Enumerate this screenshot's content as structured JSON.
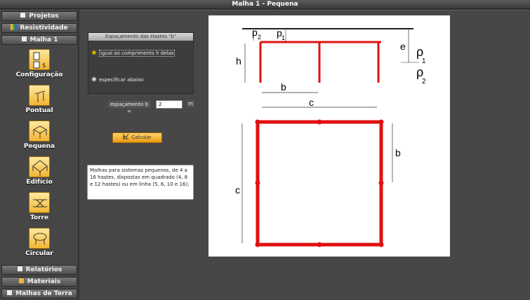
{
  "window": {
    "title": "Malha 1 - Pequena"
  },
  "sidebar": {
    "top_buttons": [
      {
        "label": "Projetos",
        "icon": "document-icon"
      },
      {
        "label": "Resistividade",
        "icon": "chart-icon"
      },
      {
        "label": "Malha 1",
        "icon": "document-icon"
      }
    ],
    "tools": [
      {
        "label": "Configuração",
        "icon": "configuration-icon"
      },
      {
        "label": "Pontual",
        "icon": "single-rod-icon"
      },
      {
        "label": "Pequena",
        "icon": "small-grid-icon"
      },
      {
        "label": "Edifício",
        "icon": "building-icon"
      },
      {
        "label": "Torre",
        "icon": "tower-icon"
      },
      {
        "label": "Circular",
        "icon": "circular-icon"
      }
    ],
    "bottom_buttons": [
      {
        "label": "Relatórios",
        "icon": "document-icon"
      },
      {
        "label": "Materiais",
        "icon": "materials-icon"
      },
      {
        "label": "Malhas de Terra",
        "icon": "grounding-icon"
      }
    ]
  },
  "spacing_panel": {
    "header": "Espaçamento das Hastes \"b\"",
    "option_equal": "igual ao comprimento h delas",
    "option_specify": "especificar abaixo",
    "selected": "option_equal"
  },
  "spacing_field": {
    "label": "espaçamento b =",
    "value": "2",
    "unit": "m"
  },
  "calc_button": {
    "label": "Calcular",
    "icon": "calculator-icon"
  },
  "description": "Malhas para sistemas pequenos, de 4 a 16 hastes, dispostas em quadrado (4, 8 e 12 hastes) ou em linha (5, 6, 10 e 16);",
  "diagram": {
    "labels": {
      "p2_top": "p",
      "p2_top_sub": "2",
      "p1_top": "p",
      "p1_top_sub": "1",
      "h": "h",
      "e": "e",
      "rho1": "ρ",
      "rho1_sub": "1",
      "rho2": "ρ",
      "rho2_sub": "2",
      "b_top": "b",
      "c_top": "c",
      "b_side": "b",
      "c_side": "c"
    },
    "accent_color": "#e01010"
  }
}
